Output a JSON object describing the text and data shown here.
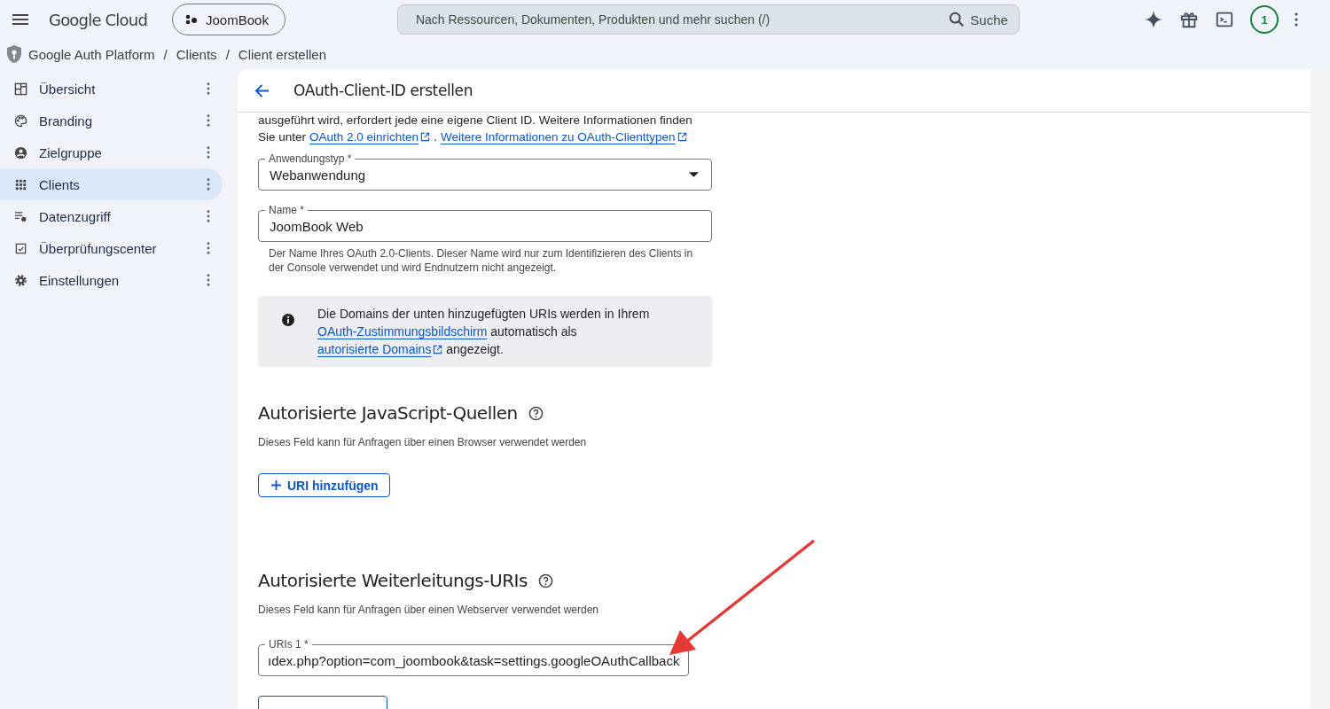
{
  "topbar": {
    "product": "Google Cloud",
    "project": "JoomBook",
    "search": {
      "placeholder": "Nach Ressourcen, Dokumenten, Produkten und mehr suchen (/)",
      "button": "Suche"
    },
    "notifications": "1"
  },
  "breadcrumb": {
    "separator": "/",
    "items": [
      "Google Auth Platform",
      "Clients",
      "Client erstellen"
    ]
  },
  "sidebar": {
    "items": [
      {
        "label": "Übersicht",
        "selected": false
      },
      {
        "label": "Branding",
        "selected": false
      },
      {
        "label": "Zielgruppe",
        "selected": false
      },
      {
        "label": "Clients",
        "selected": true
      },
      {
        "label": "Datenzugriff",
        "selected": false
      },
      {
        "label": "Überprüfungscenter",
        "selected": false
      },
      {
        "label": "Einstellungen",
        "selected": false
      }
    ]
  },
  "page": {
    "title": "OAuth-Client-ID erstellen",
    "intro": {
      "cut_line": "ausgeführt wird, erfordert jede eine eigene Client ID. Weitere Informationen finden",
      "before": "Sie unter",
      "link1": "OAuth 2.0 einrichten",
      "between": ".",
      "link2": "Weitere Informationen zu OAuth-Clienttypen"
    },
    "app_type": {
      "label": "Anwendungstyp *",
      "value": "Webanwendung"
    },
    "name": {
      "label": "Name *",
      "value": "JoomBook Web",
      "hint": "Der Name Ihres OAuth 2.0-Clients. Dieser Name wird nur zum Identifizieren des Clients in der Console verwendet und wird Endnutzern nicht angezeigt."
    },
    "info": {
      "text1": "Die Domains der unten hinzugefügten URIs werden in Ihrem",
      "link1": "OAuth-Zustimmungsbildschirm",
      "text2": "automatisch als",
      "link2": "autorisierte Domains",
      "text3": "angezeigt."
    },
    "sections": [
      {
        "title": "Autorisierte JavaScript-Quellen",
        "description": "Dieses Feld kann für Anfragen über einen Browser verwendet werden",
        "add_button": "URI hinzufügen"
      },
      {
        "title": "Autorisierte Weiterleitungs-URIs",
        "description": "Dieses Feld kann für Anfragen über einen Webserver verwendet werden",
        "uris": [
          {
            "label": "URIs 1 *",
            "value": "ıdex.php?option=com_joombook&task=settings.googleOAuthCallback"
          }
        ]
      }
    ]
  }
}
